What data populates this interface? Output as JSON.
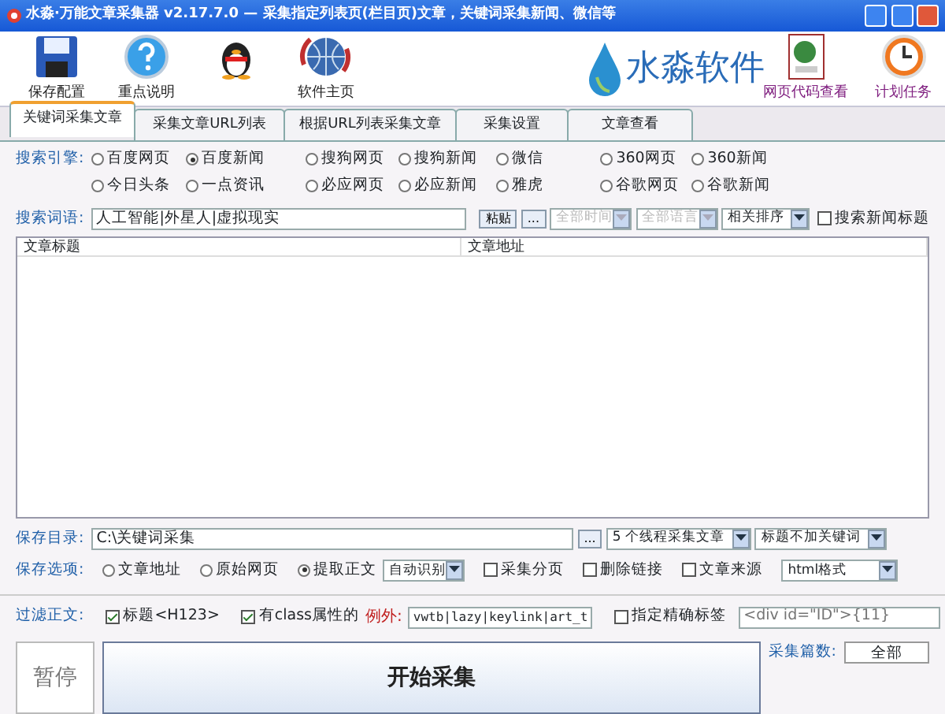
{
  "window": {
    "title": "水淼·万能文章采集器 v2.17.7.0 — 采集指定列表页(栏目页)文章，关键词采集新闻、微信等"
  },
  "toolbar": [
    {
      "kind": "save",
      "label": "保存配置"
    },
    {
      "kind": "help",
      "label": "重点说明"
    },
    {
      "kind": "qq"
    },
    {
      "kind": "globe",
      "label": "软件主页"
    }
  ],
  "logo": {
    "text": "水淼软件"
  },
  "toolbar_right": [
    {
      "kind": "html",
      "label": "网页代码查看"
    },
    {
      "kind": "clock",
      "label": "计划任务"
    }
  ],
  "tabs": [
    {
      "label": "关键词采集文章",
      "selected": true
    },
    {
      "label": "采集文章URL列表",
      "selected": false
    },
    {
      "label": "根据URL列表采集文章",
      "selected": false
    },
    {
      "label": "采集设置",
      "selected": false
    },
    {
      "label": "文章查看",
      "selected": false
    }
  ],
  "engines": {
    "label": "搜索引擎:",
    "options": [
      {
        "label": "百度网页",
        "selected": false
      },
      {
        "label": "百度新闻",
        "selected": true
      },
      {
        "label": "搜狗网页",
        "selected": false
      },
      {
        "label": "搜狗新闻",
        "selected": false
      },
      {
        "label": "微信",
        "selected": false
      },
      {
        "label": "360网页",
        "selected": false
      },
      {
        "label": "360新闻",
        "selected": false
      },
      {
        "label": "今日头条",
        "selected": false
      },
      {
        "label": "一点资讯",
        "selected": false
      },
      {
        "label": "必应网页",
        "selected": false
      },
      {
        "label": "必应新闻",
        "selected": false
      },
      {
        "label": "雅虎",
        "selected": false
      },
      {
        "label": "谷歌网页",
        "selected": false
      },
      {
        "label": "谷歌新闻",
        "selected": false
      }
    ]
  },
  "keywords": {
    "label": "搜索词语:",
    "value": "人工智能|外星人|虚拟现实",
    "paste_button": "粘贴",
    "more_button": "...",
    "selects": [
      {
        "value": "全部时间",
        "disabled": true
      },
      {
        "value": "全部语言",
        "disabled": true
      },
      {
        "value": "相关排序",
        "disabled": false
      }
    ],
    "news_title": {
      "label": "搜索新闻标题",
      "checked": false
    }
  },
  "table": {
    "columns": [
      "文章标题",
      "文章地址"
    ]
  },
  "save_dir": {
    "label": "保存目录:",
    "value": "C:\\关键词采集",
    "browse_button": "...",
    "threads": "5 个线程采集文章",
    "title_mode": "标题不加关键词"
  },
  "save_options": {
    "label": "保存选项:",
    "radios": [
      {
        "label": "文章地址",
        "selected": false
      },
      {
        "label": "原始网页",
        "selected": false
      },
      {
        "label": "提取正文",
        "selected": true
      }
    ],
    "extract_mode": "自动识别",
    "checks": [
      {
        "label": "采集分页",
        "checked": false
      },
      {
        "label": "删除链接",
        "checked": false
      },
      {
        "label": "文章来源",
        "checked": false
      }
    ],
    "format": "html格式"
  },
  "filter": {
    "label": "过滤正文:",
    "checks": [
      {
        "label": "标题<H123>",
        "checked": true
      },
      {
        "label": "有class属性的",
        "checked": true
      }
    ],
    "exception_label": "例外:",
    "exception_value": "vwtb|lazy|keylink|art_t",
    "exact": {
      "label": "指定精确标签",
      "checked": false
    },
    "exact_placeholder": "<div id=\"ID\">{11}"
  },
  "pause_button": "暂停",
  "start_button": "开始采集",
  "count": {
    "label": "采集篇数:",
    "value": "全部"
  }
}
